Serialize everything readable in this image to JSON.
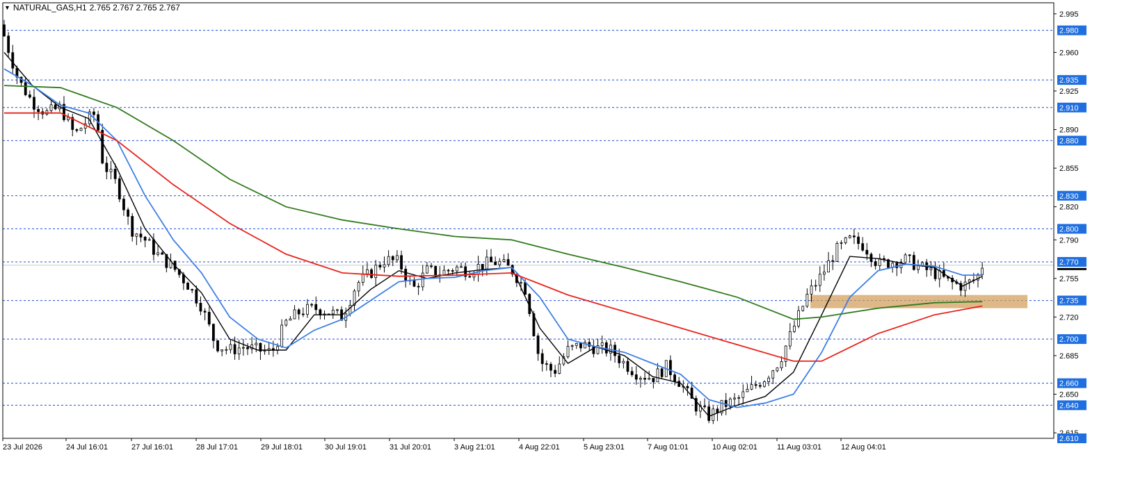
{
  "header": {
    "symbol": "NATURAL_GAS,H1",
    "ohlc": "2.765 2.767 2.765 2.767",
    "dropdown_icon": "triangle-down-icon"
  },
  "colors": {
    "background": "#ffffff",
    "frame": "#000000",
    "level_line": "#1f4fd8",
    "level_label_bg": "#1f6fe0",
    "level_label_text": "#ffffff",
    "price_line": "#c8c8c8",
    "current_price_bg": "#000000",
    "candle": "#000000",
    "ma_fast": "#000000",
    "ma_mid": "#3d7fe6",
    "ma_slow": "#e8221a",
    "ma_long": "#2f7a1c",
    "zone": "#d29a55"
  },
  "chart_data": {
    "type": "candlestick",
    "symbol": "NATURAL_GAS",
    "timeframe": "H1",
    "ylim": [
      2.61,
      3.005
    ],
    "y_ticks": [
      "2.995",
      "2.960",
      "2.925",
      "2.890",
      "2.855",
      "2.820",
      "2.790",
      "2.755",
      "2.720",
      "2.685",
      "2.650",
      "2.615"
    ],
    "horizontal_levels": [
      "2.980",
      "2.935",
      "2.910",
      "2.880",
      "2.830",
      "2.800",
      "2.770",
      "2.735",
      "2.700",
      "2.660",
      "2.640",
      "2.610"
    ],
    "current_price": 2.767,
    "x_labels": [
      "23 Jul 2026",
      "24 Jul 16:01",
      "27 Jul 16:01",
      "28 Jul 17:01",
      "29 Jul 18:01",
      "30 Jul 19:01",
      "31 Jul 20:01",
      "3 Aug 21:01",
      "4 Aug 22:01",
      "5 Aug 23:01",
      "7 Aug 01:01",
      "10 Aug 02:01",
      "11 Aug 03:01",
      "12 Aug 04:01"
    ],
    "close_path": [
      [
        0,
        2.975
      ],
      [
        1,
        2.935
      ],
      [
        2,
        2.915
      ],
      [
        3,
        2.905
      ],
      [
        4,
        2.91
      ],
      [
        5,
        2.885
      ],
      [
        6,
        2.9
      ],
      [
        6.5,
        2.905
      ],
      [
        7,
        2.86
      ],
      [
        8,
        2.84
      ],
      [
        9,
        2.8
      ],
      [
        10,
        2.79
      ],
      [
        11,
        2.775
      ],
      [
        12,
        2.765
      ],
      [
        13,
        2.75
      ],
      [
        14,
        2.73
      ],
      [
        15,
        2.695
      ],
      [
        16,
        2.69
      ],
      [
        17,
        2.693
      ],
      [
        18,
        2.69
      ],
      [
        19,
        2.688
      ],
      [
        20,
        2.715
      ],
      [
        21,
        2.725
      ],
      [
        22,
        2.728
      ],
      [
        23,
        2.725
      ],
      [
        24,
        2.72
      ],
      [
        25,
        2.75
      ],
      [
        26,
        2.76
      ],
      [
        27,
        2.772
      ],
      [
        28,
        2.77
      ],
      [
        29,
        2.745
      ],
      [
        30,
        2.762
      ],
      [
        31,
        2.76
      ],
      [
        32,
        2.765
      ],
      [
        33,
        2.762
      ],
      [
        34,
        2.768
      ],
      [
        35,
        2.77
      ],
      [
        36,
        2.763
      ],
      [
        37,
        2.745
      ],
      [
        38,
        2.68
      ],
      [
        39,
        2.67
      ],
      [
        40,
        2.69
      ],
      [
        41,
        2.695
      ],
      [
        42,
        2.692
      ],
      [
        43,
        2.69
      ],
      [
        44,
        2.678
      ],
      [
        45,
        2.668
      ],
      [
        46,
        2.665
      ],
      [
        47,
        2.675
      ],
      [
        48,
        2.66
      ],
      [
        49,
        2.64
      ],
      [
        50,
        2.63
      ],
      [
        51,
        2.64
      ],
      [
        52,
        2.645
      ],
      [
        53,
        2.655
      ],
      [
        54,
        2.665
      ],
      [
        55,
        2.68
      ],
      [
        56,
        2.71
      ],
      [
        57,
        2.74
      ],
      [
        58,
        2.758
      ],
      [
        59,
        2.78
      ],
      [
        60,
        2.79
      ],
      [
        61,
        2.785
      ],
      [
        62,
        2.768
      ],
      [
        63,
        2.77
      ],
      [
        64,
        2.772
      ],
      [
        65,
        2.765
      ],
      [
        66,
        2.76
      ],
      [
        67,
        2.752
      ],
      [
        68,
        2.748
      ],
      [
        69,
        2.755
      ],
      [
        69.4,
        2.767
      ]
    ],
    "ma_fast_label": "",
    "moving_averages": [
      {
        "color_key": "ma_fast",
        "points": [
          [
            0,
            2.96
          ],
          [
            2,
            2.93
          ],
          [
            4,
            2.91
          ],
          [
            6,
            2.9
          ],
          [
            8,
            2.855
          ],
          [
            10,
            2.8
          ],
          [
            12,
            2.768
          ],
          [
            14,
            2.742
          ],
          [
            16,
            2.7
          ],
          [
            18,
            2.69
          ],
          [
            20,
            2.69
          ],
          [
            22,
            2.722
          ],
          [
            24,
            2.722
          ],
          [
            26,
            2.745
          ],
          [
            28,
            2.762
          ],
          [
            30,
            2.755
          ],
          [
            32,
            2.76
          ],
          [
            34,
            2.763
          ],
          [
            36,
            2.765
          ],
          [
            38,
            2.71
          ],
          [
            40,
            2.678
          ],
          [
            42,
            2.693
          ],
          [
            44,
            2.685
          ],
          [
            46,
            2.666
          ],
          [
            48,
            2.66
          ],
          [
            50,
            2.63
          ],
          [
            52,
            2.64
          ],
          [
            54,
            2.648
          ],
          [
            56,
            2.67
          ],
          [
            58,
            2.722
          ],
          [
            60,
            2.775
          ],
          [
            62,
            2.773
          ],
          [
            64,
            2.768
          ],
          [
            66,
            2.765
          ],
          [
            68,
            2.748
          ],
          [
            69.4,
            2.757
          ]
        ]
      },
      {
        "color_key": "ma_mid",
        "points": [
          [
            0,
            2.945
          ],
          [
            2,
            2.93
          ],
          [
            4,
            2.912
          ],
          [
            6,
            2.905
          ],
          [
            8,
            2.88
          ],
          [
            10,
            2.83
          ],
          [
            12,
            2.79
          ],
          [
            14,
            2.76
          ],
          [
            16,
            2.72
          ],
          [
            18,
            2.7
          ],
          [
            20,
            2.692
          ],
          [
            22,
            2.708
          ],
          [
            24,
            2.718
          ],
          [
            26,
            2.735
          ],
          [
            28,
            2.752
          ],
          [
            30,
            2.755
          ],
          [
            32,
            2.756
          ],
          [
            34,
            2.762
          ],
          [
            36,
            2.765
          ],
          [
            38,
            2.738
          ],
          [
            40,
            2.7
          ],
          [
            42,
            2.693
          ],
          [
            44,
            2.688
          ],
          [
            46,
            2.678
          ],
          [
            48,
            2.668
          ],
          [
            50,
            2.645
          ],
          [
            52,
            2.638
          ],
          [
            54,
            2.642
          ],
          [
            56,
            2.65
          ],
          [
            58,
            2.688
          ],
          [
            60,
            2.738
          ],
          [
            62,
            2.762
          ],
          [
            64,
            2.768
          ],
          [
            66,
            2.766
          ],
          [
            68,
            2.758
          ],
          [
            69.4,
            2.758
          ]
        ]
      },
      {
        "color_key": "ma_slow",
        "points": [
          [
            0,
            2.905
          ],
          [
            4,
            2.905
          ],
          [
            8,
            2.88
          ],
          [
            12,
            2.84
          ],
          [
            16,
            2.805
          ],
          [
            20,
            2.777
          ],
          [
            24,
            2.76
          ],
          [
            28,
            2.757
          ],
          [
            32,
            2.758
          ],
          [
            36,
            2.76
          ],
          [
            40,
            2.74
          ],
          [
            44,
            2.725
          ],
          [
            48,
            2.71
          ],
          [
            52,
            2.695
          ],
          [
            56,
            2.68
          ],
          [
            58,
            2.68
          ],
          [
            62,
            2.705
          ],
          [
            66,
            2.722
          ],
          [
            69.4,
            2.73
          ]
        ]
      },
      {
        "color_key": "ma_long",
        "points": [
          [
            0,
            2.93
          ],
          [
            4,
            2.928
          ],
          [
            8,
            2.91
          ],
          [
            12,
            2.88
          ],
          [
            16,
            2.845
          ],
          [
            20,
            2.82
          ],
          [
            24,
            2.808
          ],
          [
            28,
            2.8
          ],
          [
            32,
            2.793
          ],
          [
            36,
            2.79
          ],
          [
            40,
            2.777
          ],
          [
            44,
            2.765
          ],
          [
            48,
            2.752
          ],
          [
            52,
            2.738
          ],
          [
            56,
            2.718
          ],
          [
            58,
            2.72
          ],
          [
            62,
            2.728
          ],
          [
            66,
            2.733
          ],
          [
            69.4,
            2.734
          ]
        ]
      }
    ],
    "zone": {
      "x_from": 57.2,
      "x_to": 72.6,
      "y_from": 2.728,
      "y_to": 2.74
    }
  }
}
